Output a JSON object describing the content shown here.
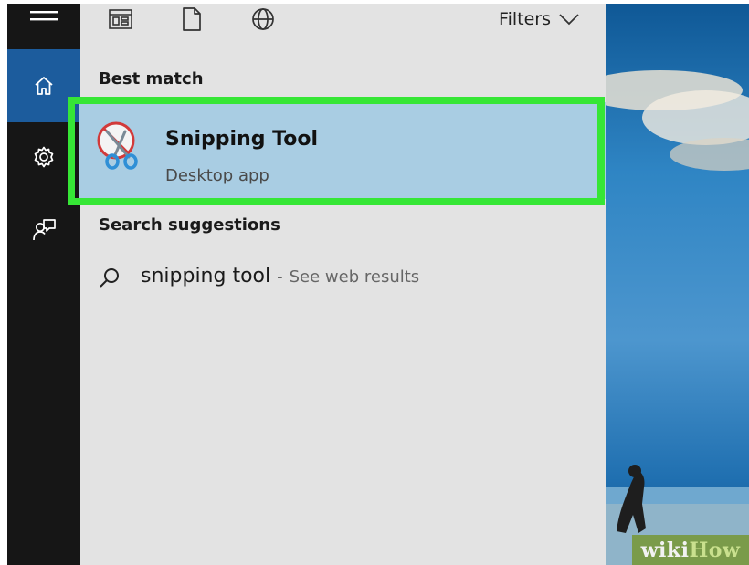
{
  "toolbar": {
    "apps_icon": "apps-icon",
    "documents_icon": "document-icon",
    "web_icon": "globe-icon",
    "filters_label": "Filters",
    "filters_icon": "chevron-down-icon"
  },
  "rail": {
    "menu_icon": "hamburger-icon",
    "home_icon": "home-icon",
    "settings_icon": "gear-icon",
    "feedback_icon": "feedback-icon",
    "active_color": "#1c5c9d"
  },
  "best_match": {
    "section_label": "Best match",
    "title": "Snipping Tool",
    "subtitle": "Desktop app",
    "icon": "snipping-tool-icon",
    "highlight_color": "#36e636",
    "selected_bg": "#a9cde3"
  },
  "suggestions": {
    "section_label": "Search suggestions",
    "items": [
      {
        "query": "snipping tool",
        "separator": "-",
        "hint": "See web results",
        "icon": "search-icon"
      }
    ]
  },
  "watermark": {
    "part1": "wiki",
    "part2": "How"
  }
}
